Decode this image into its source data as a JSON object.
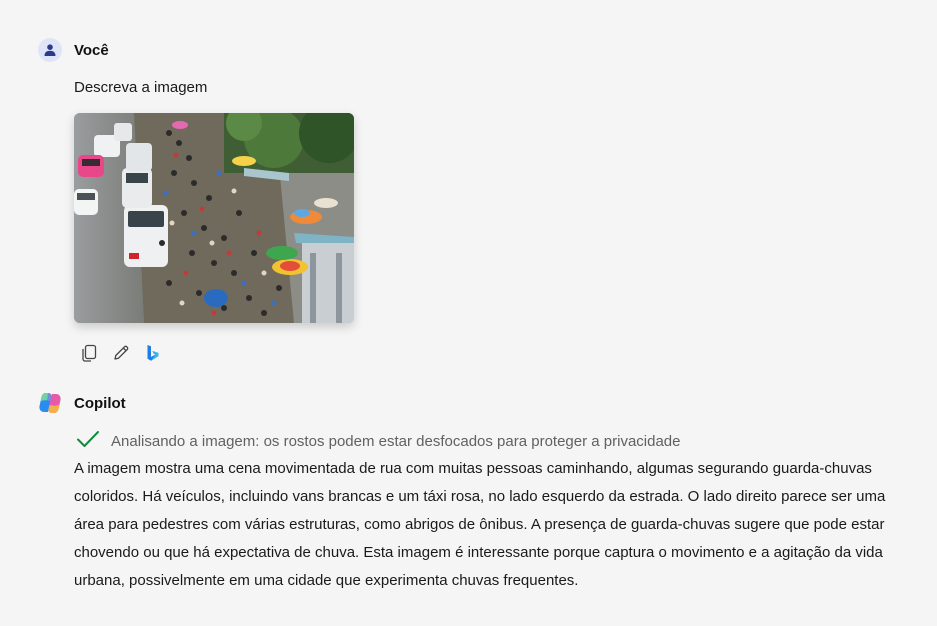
{
  "user_message": {
    "sender": "Você",
    "avatar_icon": "person-icon",
    "text": "Descreva a imagem",
    "actions": [
      {
        "icon": "copy-icon"
      },
      {
        "icon": "edit-pencil-icon"
      },
      {
        "icon": "bing-icon"
      }
    ]
  },
  "bot_message": {
    "sender": "Copilot",
    "avatar_icon": "copilot-logo-icon",
    "status_icon": "checkmark-icon",
    "status": "Analisando a imagem: os rostos podem estar desfocados para proteger a privacidade",
    "answer": "A imagem mostra uma cena movimentada de rua com muitas pessoas caminhando, algumas segurando guarda-chuvas coloridos. Há veículos, incluindo vans brancas e um táxi rosa, no lado esquerdo da estrada. O lado direito parece ser uma área para pedestres com várias estruturas, como abrigos de ônibus. A presença de guarda-chuvas sugere que pode estar chovendo ou que há expectativa de chuva. Esta imagem é interessante porque captura o movimento e a agitação da vida urbana, possivelmente em uma cidade que experimenta chuvas frequentes."
  },
  "colors": {
    "background": "#f5f5f5",
    "accent_blue": "#2b57d9",
    "success_green": "#138a3b",
    "taxi_pink": "#e8478a"
  }
}
